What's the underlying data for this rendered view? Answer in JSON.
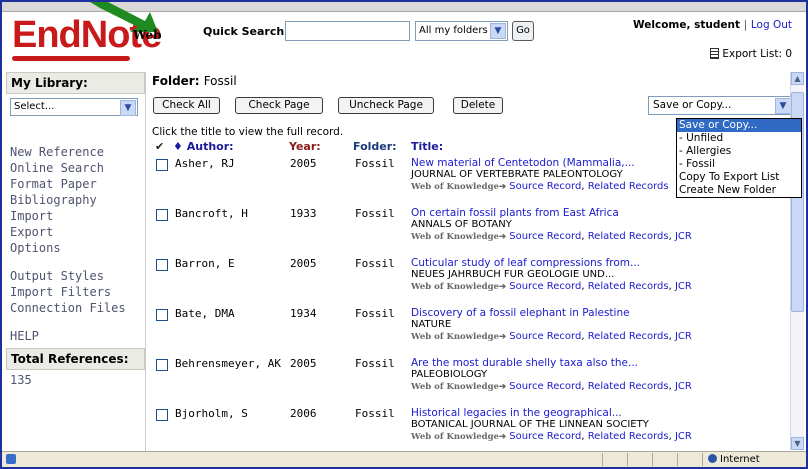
{
  "header": {
    "logo_text": "EndNote",
    "web_label": "Web",
    "quick_search_label": "Quick Search:",
    "quick_search_value": "",
    "folder_select": "All my folders",
    "go_label": "Go",
    "welcome_prefix": "Welcome, student",
    "separator": "|",
    "logout_label": "Log Out",
    "export_list_label": "Export List: 0"
  },
  "sidebar": {
    "library_header": "My Library:",
    "library_select": "Select...",
    "nav_group1": [
      "New Reference",
      "Online Search",
      "Format Paper",
      "Bibliography",
      "Import",
      "Export",
      "Options"
    ],
    "nav_group2": [
      "Output Styles",
      "Import Filters",
      "Connection Files"
    ],
    "help_label": "HELP",
    "total_header": "Total References:",
    "total_value": "135"
  },
  "main": {
    "folder_label": "Folder:",
    "folder_name": "Fossil",
    "buttons": {
      "check_all": "Check All",
      "check_page": "Check Page",
      "uncheck_page": "Uncheck Page",
      "delete": "Delete"
    },
    "save_copy_select": "Save or Copy...",
    "hint": "Click the title to view the full record.",
    "columns": {
      "check_mark": "✔",
      "author": "Author:",
      "year": "Year:",
      "folder": "Folder:",
      "title": "Title:"
    },
    "links": {
      "wok": "Web of Knowledge",
      "source": "Source Record",
      "related": "Related Records",
      "jcr": "JCR"
    },
    "records": [
      {
        "author": "Asher, RJ",
        "year": "2005",
        "folder": "Fossil",
        "title": "New material of Centetodon (Mammalia,...",
        "journal": "JOURNAL OF VERTEBRATE PALEONTOLOGY"
      },
      {
        "author": "Bancroft, H",
        "year": "1933",
        "folder": "Fossil",
        "title": "On certain fossil plants from East Africa",
        "journal": "ANNALS OF BOTANY"
      },
      {
        "author": "Barron, E",
        "year": "2005",
        "folder": "Fossil",
        "title": "Cuticular study of leaf compressions from...",
        "journal": "NEUES JAHRBUCH FUR GEOLOGIE UND..."
      },
      {
        "author": "Bate, DMA",
        "year": "1934",
        "folder": "Fossil",
        "title": "Discovery of a fossil elephant in Palestine",
        "journal": "NATURE"
      },
      {
        "author": "Behrensmeyer, AK",
        "year": "2005",
        "folder": "Fossil",
        "title": "Are the most durable shelly taxa also the...",
        "journal": "PALEOBIOLOGY"
      },
      {
        "author": "Bjorholm, S",
        "year": "2006",
        "folder": "Fossil",
        "title": "Historical legacies in the geographical...",
        "journal": "BOTANICAL JOURNAL OF THE LINNEAN SOCIETY"
      }
    ]
  },
  "dropdown": {
    "options": [
      "Save or Copy...",
      "- Unfiled",
      "- Allergies",
      "- Fossil",
      "Copy To Export List",
      "Create New Folder"
    ],
    "selected_index": 0
  },
  "statusbar": {
    "zone": "Internet"
  },
  "colors": {
    "logo_red": "#c81a1a",
    "arrow_green": "#1f8a1f",
    "link_blue": "#1a1acc",
    "frame_blue": "#1c2f9a"
  }
}
